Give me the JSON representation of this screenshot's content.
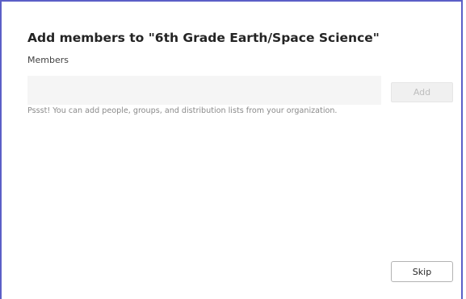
{
  "dialog": {
    "title": "Add members to \"6th Grade Earth/Space Science\"",
    "members_label": "Members",
    "members_input_value": "",
    "members_input_placeholder": "",
    "add_label": "Add",
    "hint": "Pssst! You can add people, groups, and distribution lists from your organization.",
    "skip_label": "Skip"
  },
  "colors": {
    "dialog_border": "#5b5fc7",
    "input_background": "#f5f5f5",
    "disabled_button_text": "#bdbdbd"
  }
}
